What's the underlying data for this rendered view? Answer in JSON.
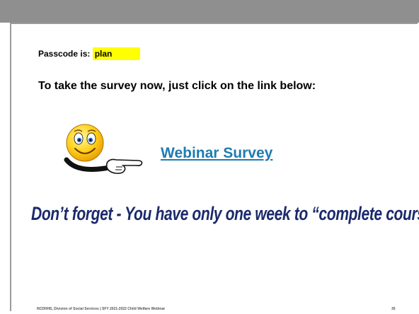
{
  "slide": {
    "passcode_label": "Passcode is: ",
    "passcode_value": "plan",
    "instruction": "To take the survey now, just click on the link below:",
    "link_text": "Webinar Survey",
    "reminder": "Don’t forget - You have only one week to “complete course”",
    "footer": "NCDHHS, Division of Social Services | SFY 2021-2022 Child Welfare Webinar",
    "page_number": "35"
  },
  "icons": {
    "smiley": "smiley-pointing-icon"
  },
  "colors": {
    "top_bar": "#8f8f8f",
    "highlight": "#ffff00",
    "link": "#1f7bb0",
    "reminder": "#1b2a6b"
  }
}
